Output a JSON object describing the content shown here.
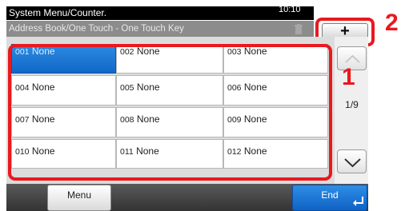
{
  "header": {
    "title": "System Menu/Counter.",
    "clock": "10:10",
    "subtitle": "Address Book/One Touch - One Touch Key",
    "add_label": "+"
  },
  "keys": [
    {
      "number": "001",
      "name": "None",
      "selected": true
    },
    {
      "number": "002",
      "name": "None"
    },
    {
      "number": "003",
      "name": "None"
    },
    {
      "number": "004",
      "name": "None"
    },
    {
      "number": "005",
      "name": "None"
    },
    {
      "number": "006",
      "name": "None"
    },
    {
      "number": "007",
      "name": "None"
    },
    {
      "number": "008",
      "name": "None"
    },
    {
      "number": "009",
      "name": "None"
    },
    {
      "number": "010",
      "name": "None"
    },
    {
      "number": "011",
      "name": "None"
    },
    {
      "number": "012",
      "name": "None"
    }
  ],
  "pagination": {
    "current_of_total": "1/9"
  },
  "callouts": {
    "one": "1",
    "two": "2"
  },
  "footer": {
    "menu_label": "Menu",
    "end_label": "End"
  },
  "colors": {
    "highlight": "#e8191f",
    "selected_key": "#1c77d6"
  }
}
